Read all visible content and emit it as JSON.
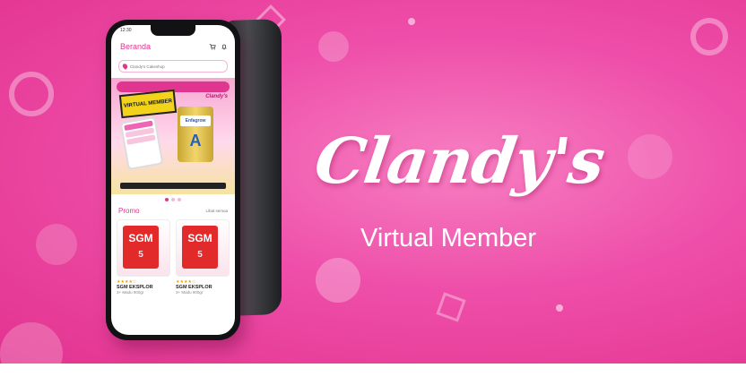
{
  "colors": {
    "accent": "#e0368f",
    "background": "#ee4ea9",
    "text_on_bg": "#ffffff"
  },
  "phone": {
    "status_time": "12:30",
    "app_title": "Beranda",
    "icons": [
      "cart-icon",
      "bell-icon",
      "location-pin-icon"
    ],
    "location_text": "Clandy's Cakeshop",
    "banner": {
      "badge": "VIRTUAL MEMBER",
      "brand": "Clandy's",
      "product_label": "Enfagrow",
      "product_letter": "A"
    },
    "promo_title": "Promo",
    "see_all": "Lihat semua",
    "products": [
      {
        "brand": "SGM",
        "number": "5",
        "name": "SGM EKSPLOR",
        "sub": "3+ Madu 900gr",
        "rating": "★★★★☆"
      },
      {
        "brand": "SGM",
        "number": "5",
        "name": "SGM EKSPLOR",
        "sub": "3+ Madu 900gr",
        "rating": "★★★★☆"
      }
    ]
  },
  "headline": {
    "brand": "Clandy's",
    "tagline": "Virtual Member"
  }
}
